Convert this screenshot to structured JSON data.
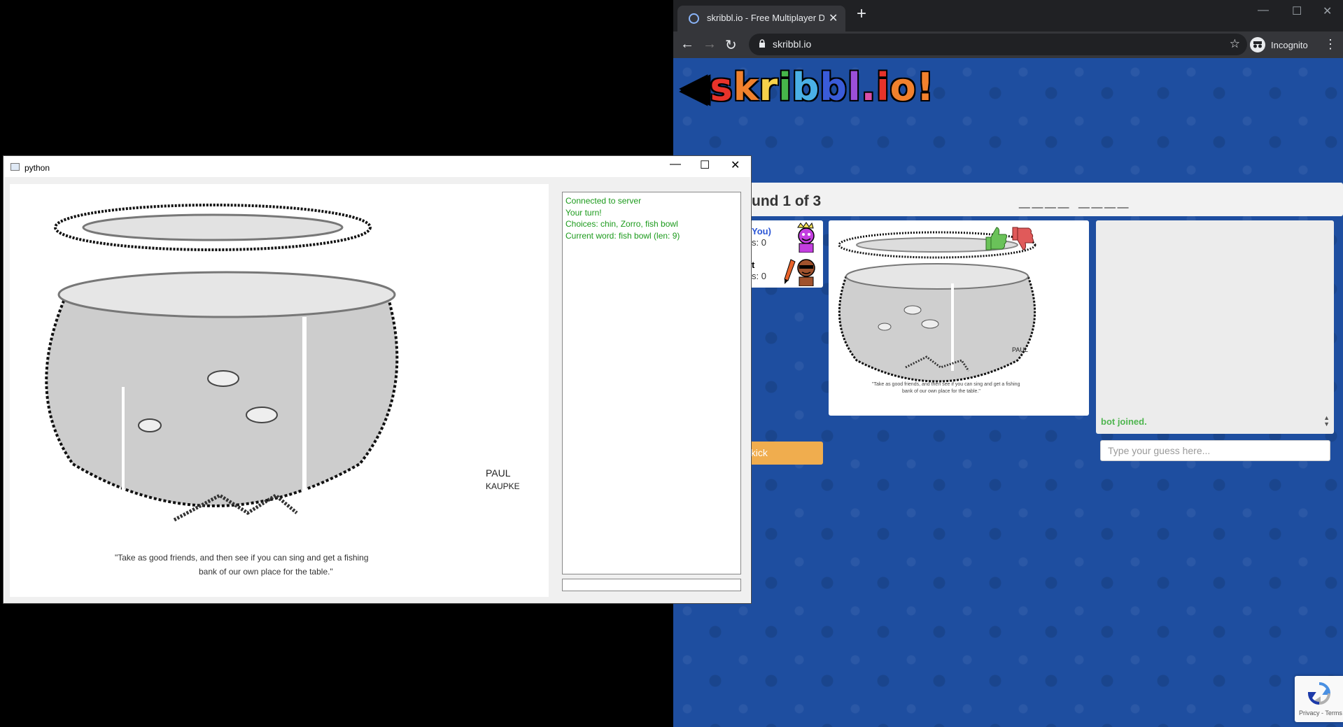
{
  "python_window": {
    "title": "python",
    "log": [
      "Connected to server",
      "Your turn!",
      "Choices: chin, Zorro, fish bowl",
      "Current word: fish bowl (len: 9)"
    ],
    "caption_line1": "\"Take as good friends, and then see if you can sing and get a fishing",
    "caption_line2": "bank of our own place for the table.\""
  },
  "browser": {
    "tab_title": "skribbl.io - Free Multiplayer Drawing",
    "url": "skribbl.io",
    "incognito_label": "Incognito"
  },
  "skribbl": {
    "logo": "skribbl.io",
    "round_text": "und 1 of 3",
    "word_hint": "____ ____",
    "players": [
      {
        "name": "You)",
        "score": "s: 0"
      },
      {
        "name": "t",
        "score": "s: 0"
      }
    ],
    "chat_message": "bot joined.",
    "guess_placeholder": "Type your guess here...",
    "votekick_label": "ekick",
    "recaptcha_terms": "Privacy - Terms"
  }
}
